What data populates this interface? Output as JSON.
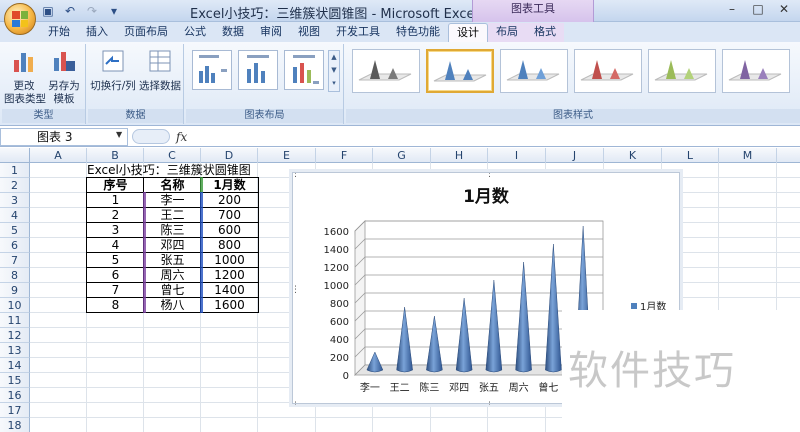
{
  "window": {
    "title": "Excel小技巧：三维簇状圆锥图 - Microsoft Excel",
    "chart_tools": "图表工具"
  },
  "tabs": [
    {
      "label": "开始",
      "active": false
    },
    {
      "label": "插入",
      "active": false
    },
    {
      "label": "页面布局",
      "active": false
    },
    {
      "label": "公式",
      "active": false
    },
    {
      "label": "数据",
      "active": false
    },
    {
      "label": "审阅",
      "active": false
    },
    {
      "label": "视图",
      "active": false
    },
    {
      "label": "开发工具",
      "active": false
    },
    {
      "label": "特色功能",
      "active": false
    },
    {
      "label": "设计",
      "active": true
    },
    {
      "label": "布局",
      "active": false
    },
    {
      "label": "格式",
      "active": false
    }
  ],
  "ribbon": {
    "type_group": {
      "label": "类型",
      "change_type": "更改\n图表类型",
      "save_template": "另存为\n模板"
    },
    "data_group": {
      "label": "数据",
      "switch_row_col": "切换行/列",
      "select_data": "选择数据"
    },
    "layout_group": {
      "label": "图表布局"
    },
    "style_group": {
      "label": "图表样式"
    }
  },
  "formula_bar": {
    "name_box": "图表 3",
    "fx": "fx",
    "formula": ""
  },
  "columns": [
    "A",
    "B",
    "C",
    "D",
    "E",
    "F",
    "G",
    "H",
    "I",
    "J",
    "K",
    "L",
    "M"
  ],
  "rows": [
    "1",
    "2",
    "3",
    "4",
    "5",
    "6",
    "7",
    "8",
    "9",
    "10",
    "11",
    "12",
    "13",
    "14",
    "15",
    "16",
    "17",
    "18"
  ],
  "sheet": {
    "title_cell": "Excel小技巧：三维簇状圆锥图",
    "headers": [
      "序号",
      "名称",
      "1月数"
    ],
    "rows": [
      [
        "1",
        "李一",
        "200"
      ],
      [
        "2",
        "王二",
        "700"
      ],
      [
        "3",
        "陈三",
        "600"
      ],
      [
        "4",
        "邓四",
        "800"
      ],
      [
        "5",
        "张五",
        "1000"
      ],
      [
        "6",
        "周六",
        "1200"
      ],
      [
        "7",
        "曾七",
        "1400"
      ],
      [
        "8",
        "杨八",
        "1600"
      ]
    ]
  },
  "chart_data": {
    "type": "bar",
    "subtype": "3d-clustered-cone",
    "title": "1月数",
    "categories": [
      "李一",
      "王二",
      "陈三",
      "邓四",
      "张五",
      "周六",
      "曾七",
      "杨八"
    ],
    "series": [
      {
        "name": "1月数",
        "values": [
          200,
          700,
          600,
          800,
          1000,
          1200,
          1400,
          1600
        ],
        "color": "#4f81bd"
      }
    ],
    "ylim": [
      0,
      1600
    ],
    "yticks": [
      0,
      200,
      400,
      600,
      800,
      1000,
      1200,
      1400,
      1600
    ],
    "grid": true,
    "legend": "right"
  },
  "watermark": "软件技巧"
}
